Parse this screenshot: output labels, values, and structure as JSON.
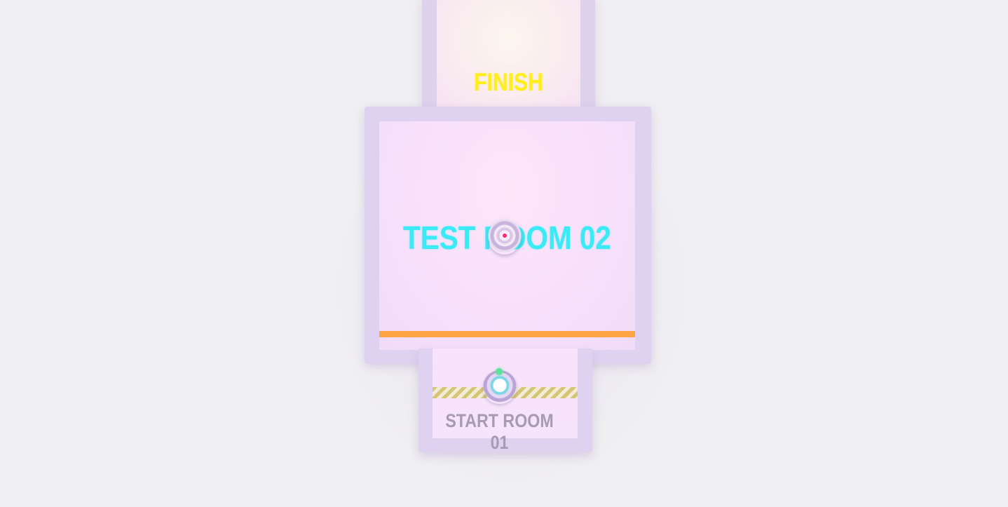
{
  "level": {
    "finish_label": "FINISH",
    "test_room_label": "TEST ROOM 02",
    "start_room_label": "START ROOM 01"
  },
  "colors": {
    "finish_text": "#ffee1a",
    "finish_line": "#fcf513",
    "test_room_text": "#3aeaf4",
    "checkpoint_line": "#fda545",
    "start_room_text": "#a69bb3",
    "player_indicator": "#5ee39b",
    "turret_core": "#ff2e6a",
    "wall": "#dfd2f0",
    "floor": "#f8e0fb"
  },
  "entities": {
    "player": {
      "icon": "player-ball-icon"
    },
    "turret": {
      "icon": "turret-target-icon"
    }
  }
}
